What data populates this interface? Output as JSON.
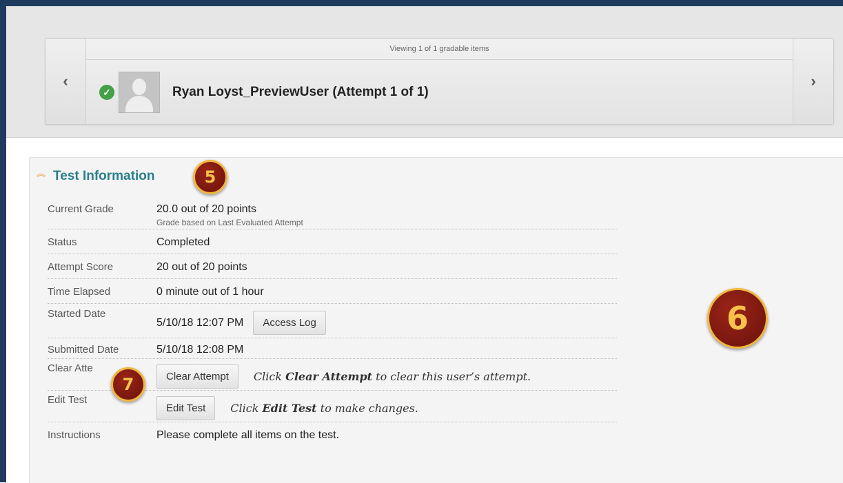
{
  "nav": {
    "viewing_text": "Viewing 1 of 1 gradable items",
    "prev_glyph": "‹",
    "next_glyph": "›",
    "user_name": "Ryan Loyst_PreviewUser (Attempt 1 of 1)",
    "status_icon": "check-circle-icon",
    "status_color": "#43a047"
  },
  "section": {
    "title": "Test Information",
    "collapse_icon": "double-chevron-up-icon",
    "title_color": "#2a7f8a"
  },
  "badges": {
    "five": "5",
    "six": "6",
    "seven": "7"
  },
  "rows": {
    "current_grade": {
      "label": "Current Grade",
      "value": "20.0 out of 20 points",
      "note": "Grade based on Last Evaluated Attempt"
    },
    "status": {
      "label": "Status",
      "value": "Completed"
    },
    "attempt_score": {
      "label": "Attempt Score",
      "value": "20 out of 20 points"
    },
    "time_elapsed": {
      "label": "Time Elapsed",
      "value": "0 minute out of 1 hour"
    },
    "started_date": {
      "label": "Started Date",
      "value": "5/10/18 12:07 PM",
      "button": "Access Log"
    },
    "submitted_date": {
      "label": "Submitted Date",
      "value": "5/10/18 12:08 PM"
    },
    "clear_attempt": {
      "label": "Clear Atte",
      "button": "Clear Attempt",
      "hint_pre": "Click ",
      "hint_bold": "Clear Attempt",
      "hint_post": " to clear this user’s attempt."
    },
    "edit_test": {
      "label": "Edit Test",
      "button": "Edit Test",
      "hint_pre": "Click ",
      "hint_bold": "Edit Test",
      "hint_post": " to make changes."
    },
    "instructions": {
      "label": "Instructions",
      "value": "Please complete all items on the test."
    }
  }
}
